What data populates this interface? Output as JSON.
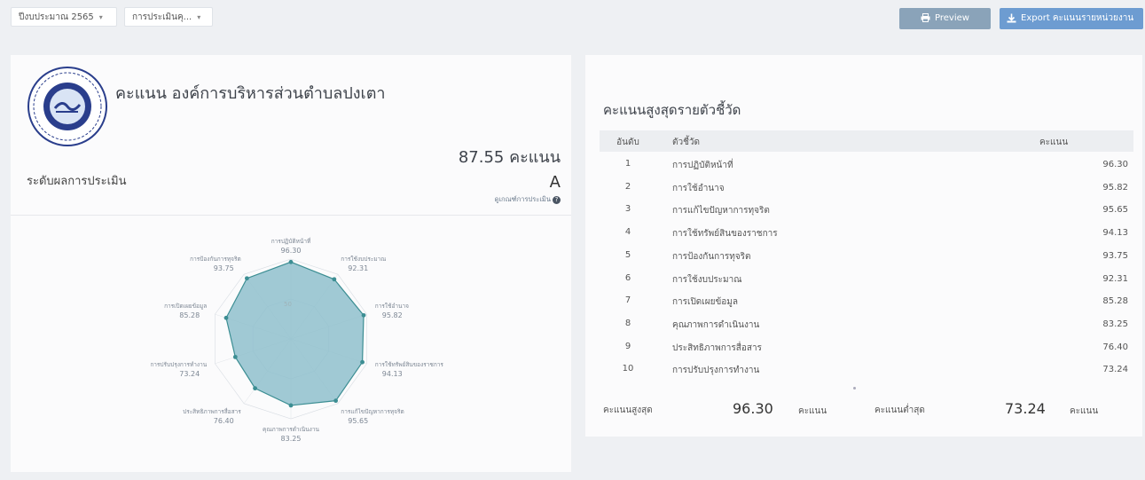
{
  "filters": {
    "year": "ปีงบประมาณ 2565",
    "assessment": "การประเมินคุ..."
  },
  "buttons": {
    "preview": "Preview",
    "export": "Export คะแนนรายหน่วยงาน"
  },
  "summary": {
    "org_title": "คะแนน องค์การบริหารส่วนตำบลปงเตา",
    "total_score": "87.55 คะแนน",
    "level_label": "ระดับผลการประเมิน",
    "grade": "A",
    "criteria_link": "ดูเกณฑ์การประเมิน"
  },
  "chart_data": {
    "type": "radar",
    "axes": [
      "การปฏิบัติหน้าที่",
      "การใช้งบประมาณ",
      "การใช้อำนาจ",
      "การใช้ทรัพย์สินของราชการ",
      "การแก้ไขปัญหาการทุจริต",
      "คุณภาพการดำเนินงาน",
      "ประสิทธิภาพการสื่อสาร",
      "การปรับปรุงการทำงาน",
      "การเปิดเผยข้อมูล",
      "การป้องกันการทุจริต"
    ],
    "values": [
      96.3,
      92.31,
      95.82,
      94.13,
      95.65,
      83.25,
      76.4,
      73.24,
      85.28,
      93.75
    ],
    "value_labels": [
      "96.30",
      "92.31",
      "95.82",
      "94.13",
      "95.65",
      "83.25",
      "76.40",
      "73.24",
      "85.28",
      "93.75"
    ],
    "rlim": [
      0,
      100
    ],
    "inner_ring_label": "50",
    "colors": {
      "fill": "#8fc0cc",
      "stroke": "#3c8e93"
    }
  },
  "ranking": {
    "title": "คะแนนสูงสุดรายตัวชี้วัด",
    "headers": {
      "rank": "อันดับ",
      "indicator": "ตัวชี้วัด",
      "score": "คะแนน"
    },
    "rows": [
      {
        "rank": "1",
        "indicator": "การปฏิบัติหน้าที่",
        "score": "96.30"
      },
      {
        "rank": "2",
        "indicator": "การใช้อำนาจ",
        "score": "95.82"
      },
      {
        "rank": "3",
        "indicator": "การแก้ไขปัญหาการทุจริต",
        "score": "95.65"
      },
      {
        "rank": "4",
        "indicator": "การใช้ทรัพย์สินของราชการ",
        "score": "94.13"
      },
      {
        "rank": "5",
        "indicator": "การป้องกันการทุจริต",
        "score": "93.75"
      },
      {
        "rank": "6",
        "indicator": "การใช้งบประมาณ",
        "score": "92.31"
      },
      {
        "rank": "7",
        "indicator": "การเปิดเผยข้อมูล",
        "score": "85.28"
      },
      {
        "rank": "8",
        "indicator": "คุณภาพการดำเนินงาน",
        "score": "83.25"
      },
      {
        "rank": "9",
        "indicator": "ประสิทธิภาพการสื่อสาร",
        "score": "76.40"
      },
      {
        "rank": "10",
        "indicator": "การปรับปรุงการทำงาน",
        "score": "73.24"
      }
    ],
    "max_label": "คะแนนสูงสุด",
    "max_value": "96.30",
    "min_label": "คะแนนต่ำสุด",
    "min_value": "73.24",
    "unit": "คะแนน"
  }
}
